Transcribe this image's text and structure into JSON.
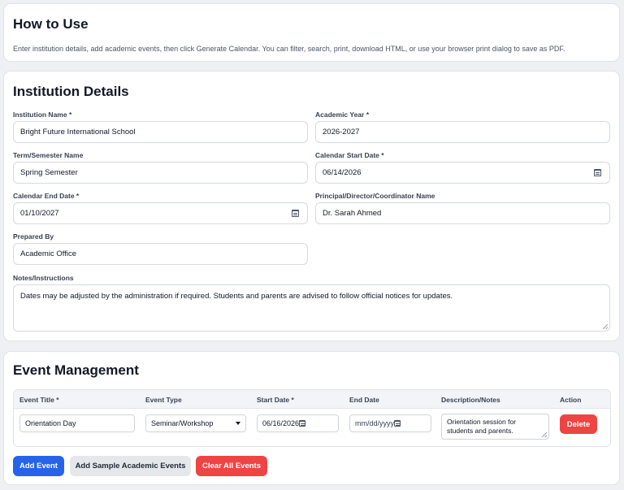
{
  "how_to": {
    "title": "How to Use",
    "text": "Enter institution details, add academic events, then click Generate Calendar. You can filter, search, print, download HTML, or use your browser print dialog to save as PDF."
  },
  "institution": {
    "title": "Institution Details",
    "name_label": "Institution Name *",
    "name_value": "Bright Future International School",
    "year_label": "Academic Year *",
    "year_value": "2026-2027",
    "term_label": "Term/Semester Name",
    "term_value": "Spring Semester",
    "start_label": "Calendar Start Date *",
    "start_value": "06/14/2026",
    "end_label": "Calendar End Date *",
    "end_value": "01/10/2027",
    "principal_label": "Principal/Director/Coordinator Name",
    "principal_value": "Dr. Sarah Ahmed",
    "prepared_label": "Prepared By",
    "prepared_value": "Academic Office",
    "notes_label": "Notes/Instructions",
    "notes_value": "Dates may be adjusted by the administration if required. Students and parents are advised to follow official notices for updates."
  },
  "events": {
    "title": "Event Management",
    "columns": [
      "Event Title *",
      "Event Type",
      "Start Date *",
      "End Date",
      "Description/Notes",
      "Action"
    ],
    "rows": [
      {
        "title": "Orientation Day",
        "type": "Seminar/Workshop",
        "start": "06/16/2026",
        "end_placeholder": "mm/dd/yyyy",
        "description": "Orientation session for students and parents.",
        "action": "Delete"
      }
    ],
    "buttons": {
      "add": "Add Event",
      "sample": "Add Sample Academic Events",
      "clear": "Clear All Events"
    }
  },
  "icons": {
    "date_picker": "calendar-icon",
    "select": "chevron-down-icon",
    "textarea_resize": "resize-grip-icon"
  },
  "colors": {
    "primary": "#2563eb",
    "danger": "#ef4444",
    "neutral_button": "#e5e7eb",
    "page_background": "#eef0f4"
  }
}
